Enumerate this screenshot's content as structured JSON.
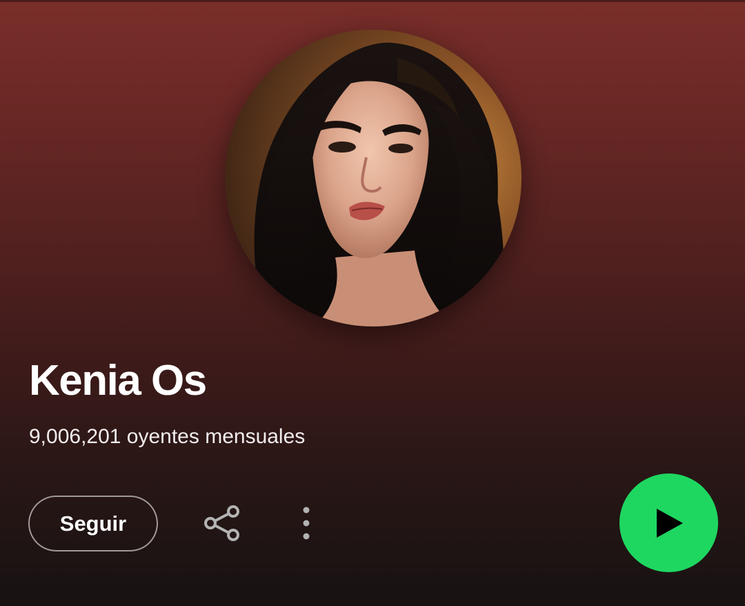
{
  "artist": {
    "name": "Kenia Os",
    "listeners_text": "9,006,201 oyentes mensuales",
    "photo_icon": "artist-photo"
  },
  "actions": {
    "follow_label": "Seguir",
    "share_icon": "share-icon",
    "more_icon": "more-options-icon",
    "play_icon": "play-icon"
  },
  "colors": {
    "header_top": "#7a2e2a",
    "header_bottom": "#171212",
    "play_green": "#1ed760",
    "text": "#ffffff"
  }
}
